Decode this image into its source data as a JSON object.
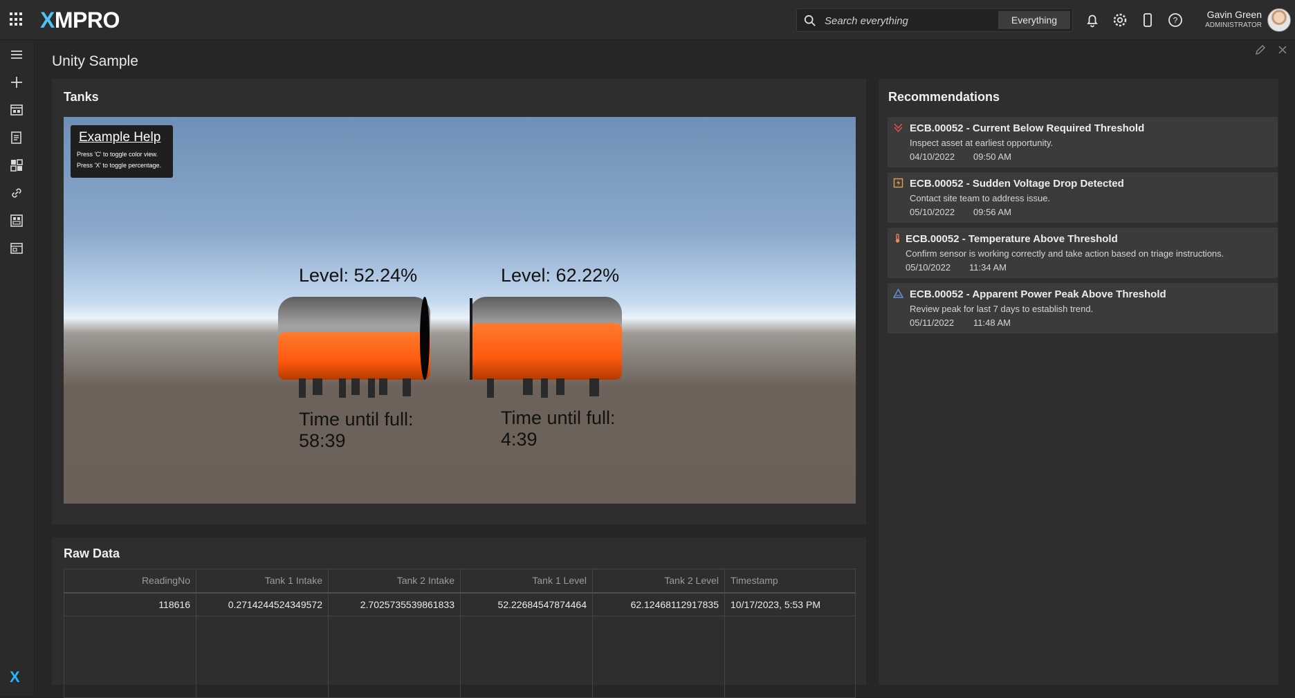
{
  "header": {
    "logo": {
      "prefix": "X",
      "rest": "MPRO"
    },
    "search": {
      "placeholder": "Search everything",
      "scope": "Everything"
    },
    "user": {
      "name": "Gavin Green",
      "role": "ADMINISTRATOR"
    }
  },
  "page": {
    "title": "Unity Sample"
  },
  "tanks_panel": {
    "title": "Tanks",
    "help": {
      "title": "Example Help",
      "line1": "Press 'C' to toggle color view.",
      "line2": "Press 'X' to toggle percentage."
    },
    "tanks": [
      {
        "level_text": "Level: 52.24%",
        "time_label": "Time until full:",
        "time_value": "58:39",
        "fill_fraction": 0.5224
      },
      {
        "level_text": "Level: 62.22%",
        "time_label": "Time until full:",
        "time_value": "4:39",
        "fill_fraction": 0.6222
      }
    ],
    "colors": {
      "liquid": "#ff6a1a",
      "tank_shell": "#8a8a8a"
    }
  },
  "raw_data": {
    "title": "Raw Data",
    "columns": [
      "ReadingNo",
      "Tank 1 Intake",
      "Tank 2 Intake",
      "Tank 1 Level",
      "Tank 2 Level",
      "Timestamp"
    ],
    "rows": [
      [
        "118616",
        "0.2714244524349572",
        "2.7025735539861833",
        "52.22684547874464",
        "62.12468112917835",
        "10/17/2023, 5:53 PM"
      ]
    ]
  },
  "recommendations": {
    "title": "Recommendations",
    "items": [
      {
        "icon": "current-down-icon",
        "icon_color": "#d9534f",
        "title": "ECB.00052 - Current Below Required Threshold",
        "desc": "Inspect asset at earliest opportunity.",
        "date": "04/10/2022",
        "time": "09:50 AM"
      },
      {
        "icon": "voltage-icon",
        "icon_color": "#e0a050",
        "title": "ECB.00052 - Sudden Voltage Drop Detected",
        "desc": "Contact site team to address issue.",
        "date": "05/10/2022",
        "time": "09:56 AM"
      },
      {
        "icon": "thermometer-icon",
        "icon_color": "#f08a5d",
        "title": "ECB.00052 - Temperature Above Threshold",
        "desc": "Confirm sensor is working correctly and take action based on triage instructions.",
        "date": "05/10/2022",
        "time": "11:34 AM"
      },
      {
        "icon": "warning-triangle-icon",
        "icon_color": "#6a8fd8",
        "title": "ECB.00052 - Apparent Power Peak Above Threshold",
        "desc": "Review peak for last 7 days to establish trend.",
        "date": "05/11/2022",
        "time": "11:48 AM"
      }
    ]
  }
}
